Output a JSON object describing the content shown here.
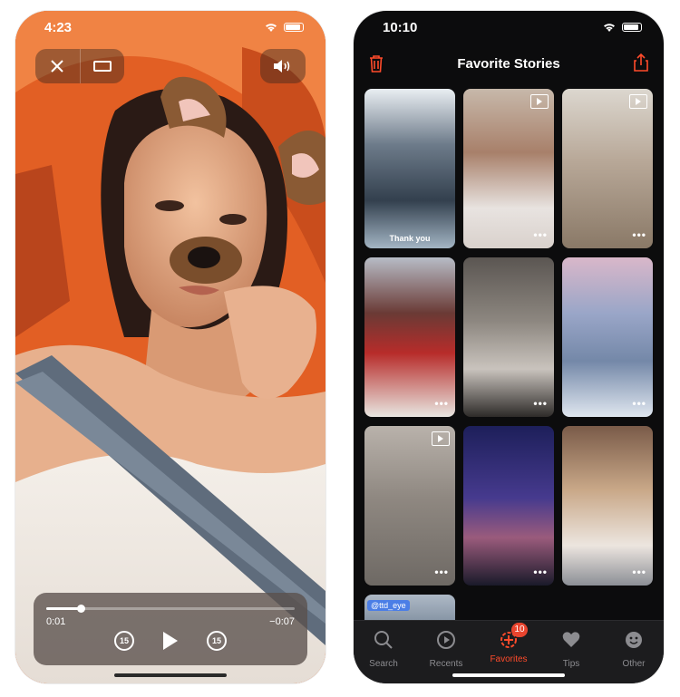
{
  "colors": {
    "accent": "#ff4b2b",
    "dark_bg": "#0c0c0d",
    "tabbar_bg": "#1c1c1e",
    "badge": "#e8442e"
  },
  "left_screen": {
    "status_time": "4:23",
    "controls": {
      "close_icon": "close-icon",
      "fit_icon": "aspect-icon",
      "volume_icon": "speaker-icon"
    },
    "player": {
      "elapsed": "0:01",
      "remaining": "−0:07",
      "progress": 0.14,
      "skip_back_label": "15",
      "skip_forward_label": "15"
    }
  },
  "right_screen": {
    "status_time": "10:10",
    "title": "Favorite Stories",
    "tiles": [
      {
        "caption": "Thank you",
        "video": false,
        "dots": ""
      },
      {
        "caption": "",
        "video": true,
        "dots": "•••"
      },
      {
        "caption": "",
        "video": true,
        "dots": "•••"
      },
      {
        "caption": "",
        "video": false,
        "dots": "•••"
      },
      {
        "caption": "",
        "video": false,
        "dots": "•••"
      },
      {
        "caption": "",
        "video": false,
        "dots": "•••"
      },
      {
        "caption": "",
        "video": true,
        "dots": "•••"
      },
      {
        "caption": "",
        "video": false,
        "dots": "•••"
      },
      {
        "caption": "",
        "video": false,
        "dots": "•••"
      },
      {
        "caption": "",
        "tag": "@ttd_eye",
        "video": false,
        "dots": ""
      }
    ],
    "tabs": [
      {
        "label": "Search",
        "icon": "search-icon",
        "active": false
      },
      {
        "label": "Recents",
        "icon": "recents-icon",
        "active": false
      },
      {
        "label": "Favorites",
        "icon": "favorites-icon",
        "active": true,
        "badge": "10"
      },
      {
        "label": "Tips",
        "icon": "heart-icon",
        "active": false
      },
      {
        "label": "Other",
        "icon": "smiley-icon",
        "active": false
      }
    ]
  }
}
